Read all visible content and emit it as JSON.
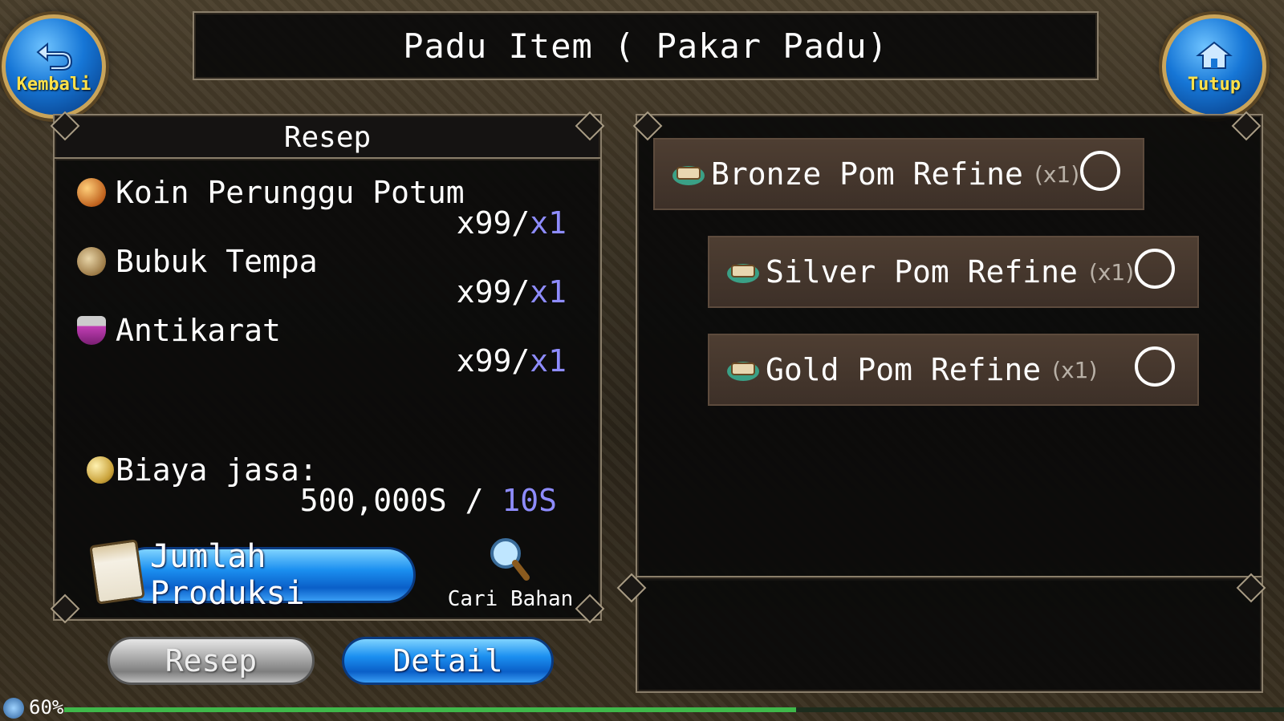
{
  "header": {
    "title": "Padu Item ( Pakar Padu)",
    "back_label": "Kembali",
    "close_label": "Tutup"
  },
  "recipe": {
    "header": "Resep",
    "materials": [
      {
        "name": "Koin Perunggu Potum",
        "have": "x99/",
        "need": "x1",
        "icon": "bronze-coin-icon"
      },
      {
        "name": "Bubuk Tempa",
        "have": "x99/",
        "need": "x1",
        "icon": "powder-bag-icon"
      },
      {
        "name": "Antikarat",
        "have": "x99/",
        "need": "x1",
        "icon": "potion-flask-icon"
      }
    ],
    "fee_label": "Biaya jasa:",
    "fee_have": "500,000S / ",
    "fee_need": "10S",
    "produce_button": "Jumlah Produksi",
    "search_label": "Cari Bahan"
  },
  "tabs": {
    "recipe": "Resep",
    "detail": "Detail"
  },
  "results": [
    {
      "name": "Bronze Pom Refine",
      "qty": "(x1)",
      "icon": "refine-box-icon"
    },
    {
      "name": "Silver Pom Refine",
      "qty": "(x1)",
      "icon": "refine-box-icon"
    },
    {
      "name": "Gold Pom Refine",
      "qty": "(x1)",
      "icon": "refine-box-icon"
    }
  ],
  "status": {
    "battery_percent_label": "60%",
    "progress": 0.6
  },
  "colors": {
    "need": "#8e8cff",
    "accent_blue": "#1b8ff0",
    "gold": "#ffe14a"
  }
}
